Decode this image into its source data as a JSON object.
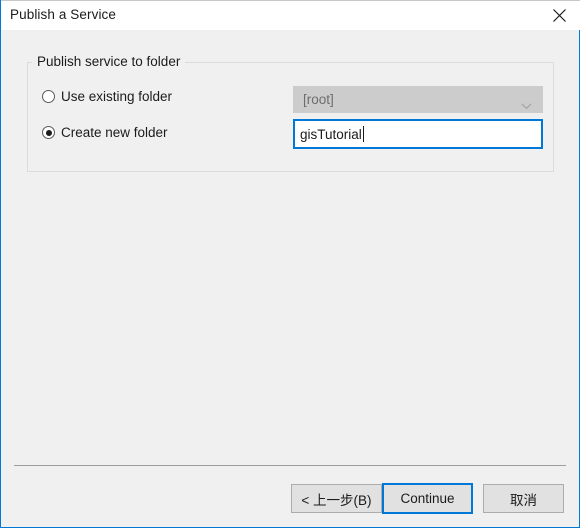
{
  "window": {
    "title": "Publish a Service",
    "close_icon": "close-icon",
    "accent_color": "#0078d7",
    "background_color": "#f0f0f0",
    "titlebar_color": "#ffffff"
  },
  "groupbox": {
    "title": "Publish service to folder"
  },
  "options": [
    {
      "id": "use-existing-folder",
      "label": "Use existing folder",
      "selected": false
    },
    {
      "id": "create-new-folder",
      "label": "Create new folder",
      "selected": true
    }
  ],
  "existing_folder_combo": {
    "value": "[root]",
    "enabled": false,
    "arrow_icon": "chevron-down-icon"
  },
  "new_folder_input": {
    "value": "gisTutorial",
    "placeholder": "",
    "focused": true
  },
  "footer": {
    "back_label": "< 上一步(B)",
    "continue_label": "Continue",
    "cancel_label": "取消",
    "default_button": "Continue"
  }
}
